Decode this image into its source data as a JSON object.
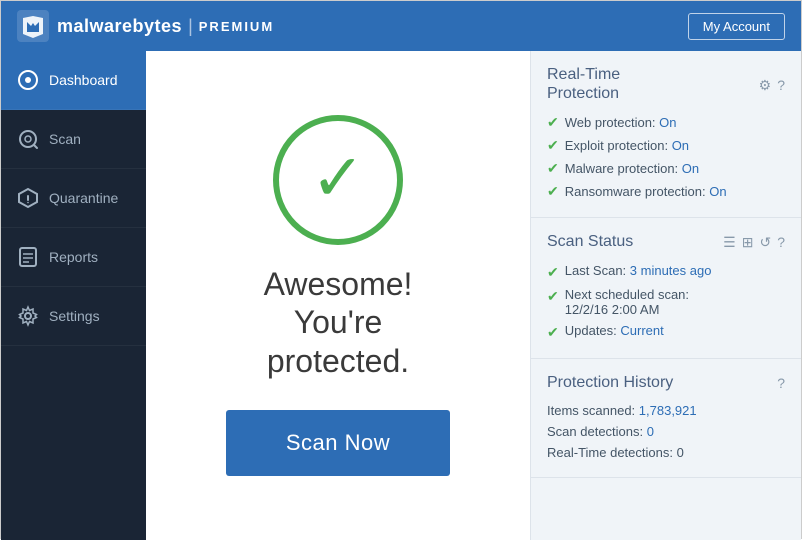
{
  "header": {
    "logo_bold": "malwarebytes",
    "logo_divider": "|",
    "logo_premium": "PREMIUM",
    "my_account_label": "My Account"
  },
  "sidebar": {
    "items": [
      {
        "id": "dashboard",
        "label": "Dashboard",
        "active": true
      },
      {
        "id": "scan",
        "label": "Scan",
        "active": false
      },
      {
        "id": "quarantine",
        "label": "Quarantine",
        "active": false
      },
      {
        "id": "reports",
        "label": "Reports",
        "active": false
      },
      {
        "id": "settings",
        "label": "Settings",
        "active": false
      }
    ]
  },
  "main": {
    "protected_line1": "Awesome!",
    "protected_line2": "You're",
    "protected_line3": "protected.",
    "scan_now_label": "Scan Now"
  },
  "real_time_protection": {
    "title": "Real-Time\nProtection",
    "items": [
      {
        "label": "Web protection:",
        "status": "On"
      },
      {
        "label": "Exploit protection:",
        "status": "On"
      },
      {
        "label": "Malware protection:",
        "status": "On"
      },
      {
        "label": "Ransomware protection:",
        "status": "On"
      }
    ]
  },
  "scan_status": {
    "title": "Scan Status",
    "items": [
      {
        "label": "Last Scan:",
        "value": "3 minutes ago",
        "blue": true
      },
      {
        "label": "Next scheduled scan:",
        "value": "12/2/16 2:00 AM",
        "blue": false,
        "value_label": "12/2/16 2:00 AM"
      },
      {
        "label": "Updates:",
        "value": "Current",
        "blue": true
      }
    ]
  },
  "protection_history": {
    "title": "Protection History",
    "items": [
      {
        "label": "Items scanned:",
        "value": "1,783,921",
        "blue": false
      },
      {
        "label": "Scan detections:",
        "value": "0",
        "blue": true
      },
      {
        "label": "Real-Time detections:",
        "value": "0",
        "blue": false
      }
    ]
  }
}
